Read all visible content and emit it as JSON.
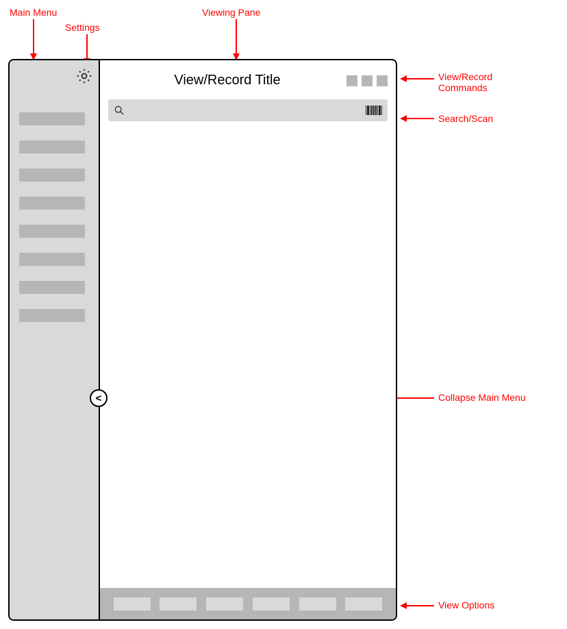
{
  "annotations": {
    "main_menu": "Main Menu",
    "settings": "Settings",
    "viewing_pane": "Viewing Pane",
    "view_record_commands": "View/Record\nCommands",
    "search_scan": "Search/Scan",
    "collapse_main_menu": "Collapse Main Menu",
    "view_options": "View Options"
  },
  "app": {
    "title": "View/Record Title",
    "search_placeholder": "",
    "sidebar": {
      "settings_icon": "gear",
      "menu_item_count": 8,
      "collapse_glyph": "<"
    },
    "commands_count": 3,
    "footer_options_count": 6
  },
  "colors": {
    "annotation": "#ff0000",
    "sidebar_bg": "#d9d9d9",
    "placeholder": "#b6b6b6"
  }
}
